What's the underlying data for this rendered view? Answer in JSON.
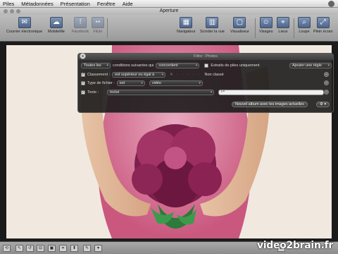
{
  "menubar": {
    "items": [
      "Piles",
      "Métadonnées",
      "Présentation",
      "Fenêtre",
      "Aide"
    ]
  },
  "window": {
    "title": "Aperture"
  },
  "toolbar": {
    "left": [
      {
        "label": "Courrier électronique",
        "icon": "mail-icon"
      },
      {
        "label": "MobileMe",
        "icon": "mobileme-icon"
      },
      {
        "label": "Facebook",
        "icon": "facebook-icon"
      },
      {
        "label": "Flickr",
        "icon": "flickr-icon"
      }
    ],
    "center": [
      {
        "label": "Navigateur",
        "icon": "browser-icon"
      },
      {
        "label": "Scinder la vue",
        "icon": "split-view-icon"
      },
      {
        "label": "Visualiseur",
        "icon": "viewer-icon"
      }
    ],
    "right": [
      {
        "label": "Visages",
        "icon": "faces-icon"
      },
      {
        "label": "Lieux",
        "icon": "places-icon"
      },
      {
        "label": "Loupe",
        "icon": "loupe-icon"
      },
      {
        "label": "Plein écran",
        "icon": "fullscreen-icon"
      }
    ]
  },
  "filter_hud": {
    "title": "Filtre : Photos",
    "match_scope": "Toutes les",
    "conditions_label": "conditions suivantes qui",
    "match_mode": "concordent",
    "stack_picks_label": "Extraits de piles uniquement",
    "add_rule": "Ajouter une règle",
    "rating": {
      "label": "Classement :",
      "operator": "est supérieur ou égal à",
      "value_text": "Non classé"
    },
    "file_type": {
      "label": "Type de fichier :",
      "operator": "est",
      "value": "vidéo"
    },
    "text": {
      "label": "Texte :",
      "operator": "inclut",
      "search_placeholder": ""
    },
    "new_album_button": "Nouvel album avec les images actuelles",
    "action_menu": "⚙ ▾"
  },
  "watermark": {
    "text": "video2brain.fr"
  },
  "colors": {
    "accent": "#5b7196",
    "hud_bg": "#1c1c1c",
    "photo_bg": "#f1e9df",
    "flower": "#8e2a5a"
  }
}
